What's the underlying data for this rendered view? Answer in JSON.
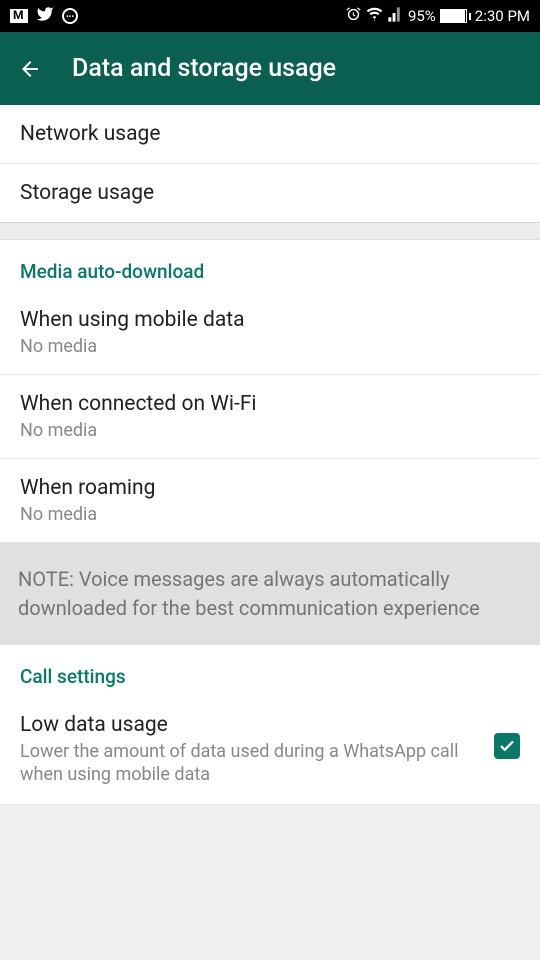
{
  "status": {
    "battery_percent": "95%",
    "time": "2:30 PM"
  },
  "header": {
    "title": "Data and storage usage"
  },
  "usage": {
    "network": "Network usage",
    "storage": "Storage usage"
  },
  "media": {
    "header": "Media auto-download",
    "mobile": {
      "title": "When using mobile data",
      "subtitle": "No media"
    },
    "wifi": {
      "title": "When connected on Wi-Fi",
      "subtitle": "No media"
    },
    "roaming": {
      "title": "When roaming",
      "subtitle": "No media"
    },
    "note": "NOTE: Voice messages are always automatically downloaded for the best communication experience"
  },
  "call": {
    "header": "Call settings",
    "low_data": {
      "title": "Low data usage",
      "desc": "Lower the amount of data used during a WhatsApp call when using mobile data",
      "checked": true
    }
  }
}
